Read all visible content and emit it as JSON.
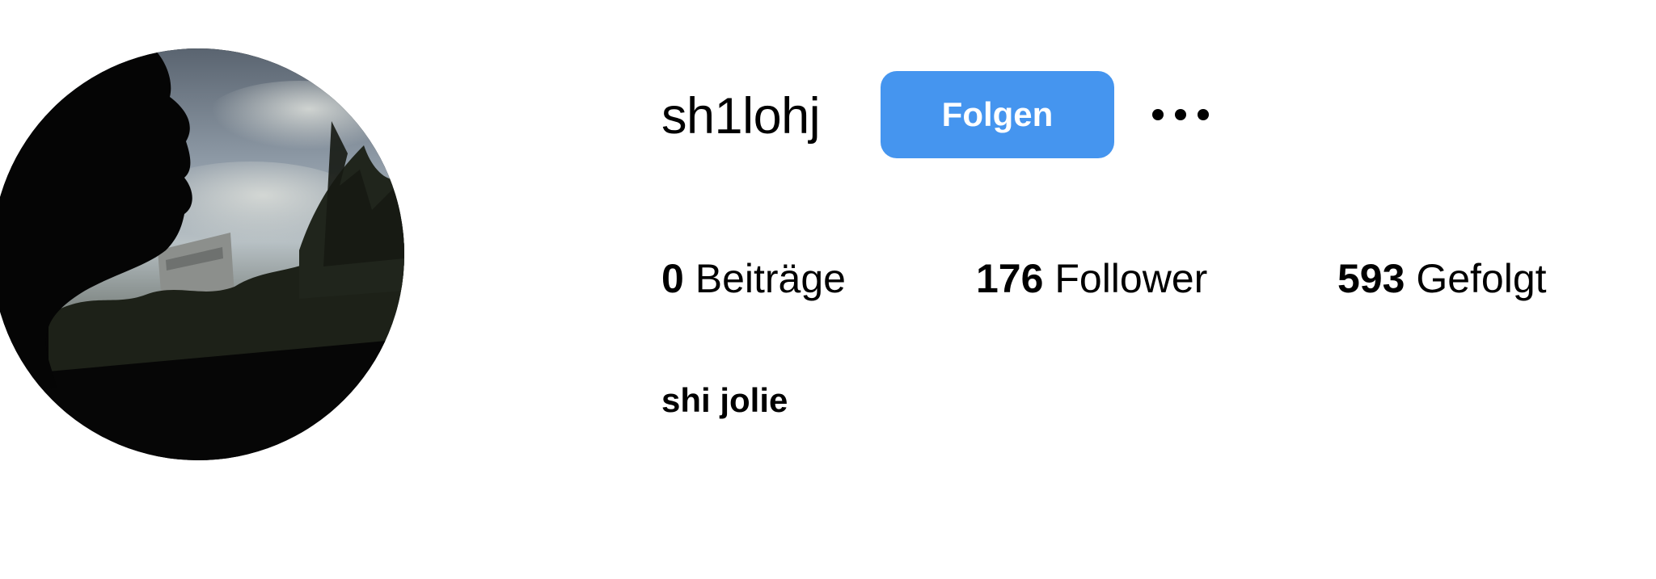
{
  "profile": {
    "username": "sh1lohj",
    "full_name": "shi jolie",
    "avatar_icon": "profile-photo-silhouette"
  },
  "actions": {
    "follow_label": "Folgen",
    "more_icon": "more-options-icon"
  },
  "stats": {
    "posts_count": "0",
    "posts_label": "Beiträge",
    "followers_count": "176",
    "followers_label": "Follower",
    "following_count": "593",
    "following_label": "Gefolgt"
  },
  "colors": {
    "follow_button": "#4595ef",
    "text": "#000000",
    "background": "#ffffff"
  }
}
